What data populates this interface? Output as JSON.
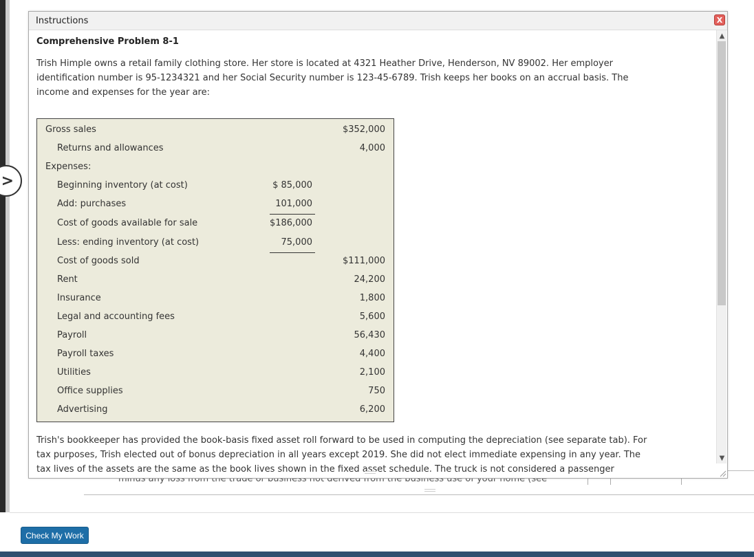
{
  "modal": {
    "title": "Instructions",
    "close_label": "X",
    "problem_title": "Comprehensive Problem 8-1",
    "intro": "Trish Himple owns a retail family clothing store. Her store is located at 4321 Heather Drive, Henderson, NV 89002. Her employer identification number is 95-1234321 and her Social Security number is 123-45-6789. Trish keeps her books on an accrual basis. The income and expenses for the year are:",
    "table": {
      "rows": [
        {
          "label": "Gross sales",
          "col1": "",
          "col2": "$352,000"
        },
        {
          "label": "Returns and allowances",
          "col1": "",
          "col2": "4,000"
        },
        {
          "label": "Expenses:",
          "col1": "",
          "col2": ""
        },
        {
          "label": "Beginning inventory (at cost)",
          "col1": "$ 85,000",
          "col2": ""
        },
        {
          "label": "Add: purchases",
          "col1": "101,000",
          "col2": ""
        },
        {
          "label": "Cost of goods available for sale",
          "col1": "$186,000",
          "col2": ""
        },
        {
          "label": "Less: ending inventory (at cost)",
          "col1": "75,000",
          "col2": ""
        },
        {
          "label": "Cost of goods sold",
          "col1": "",
          "col2": "$111,000"
        },
        {
          "label": "Rent",
          "col1": "",
          "col2": "24,200"
        },
        {
          "label": "Insurance",
          "col1": "",
          "col2": "1,800"
        },
        {
          "label": "Legal and accounting fees",
          "col1": "",
          "col2": "5,600"
        },
        {
          "label": "Payroll",
          "col1": "",
          "col2": "56,430"
        },
        {
          "label": "Payroll taxes",
          "col1": "",
          "col2": "4,400"
        },
        {
          "label": "Utilities",
          "col1": "",
          "col2": "2,100"
        },
        {
          "label": "Office supplies",
          "col1": "",
          "col2": "750"
        },
        {
          "label": "Advertising",
          "col1": "",
          "col2": "6,200"
        }
      ]
    },
    "para2": "Trish's bookkeeper has provided the book-basis fixed asset roll forward to be used in computing the depreciation (see separate tab). For tax purposes, Trish elected out of bonus depreciation in all years except 2019. She did not elect immediate expensing in any year. The tax lives of the assets are the same as the book lives shown in the fixed asset schedule. The truck is not considered a passenger automobile for"
  },
  "background": {
    "partial_text": "minus any loss from the trade or business not derived from the business use of your home (see"
  },
  "footer": {
    "check_button": "Check My Work"
  }
}
